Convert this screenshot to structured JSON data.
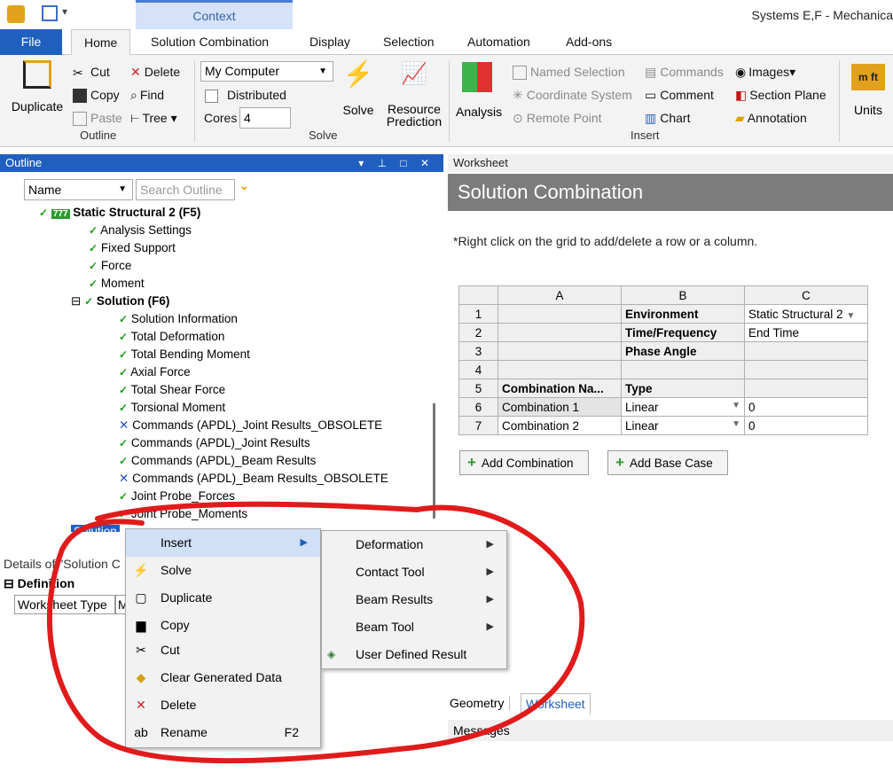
{
  "window": {
    "context_tab": "Context",
    "title": "Systems E,F - Mechanica"
  },
  "tabs": [
    "File",
    "Home",
    "Solution Combination",
    "Display",
    "Selection",
    "Automation",
    "Add-ons"
  ],
  "ribbon": {
    "outline": {
      "duplicate": "Duplicate",
      "cut": "Cut",
      "copy": "Copy",
      "paste": "Paste",
      "delete": "Delete",
      "find": "Find",
      "tree": "Tree",
      "group": "Outline"
    },
    "solve": {
      "computer": "My Computer",
      "distributed": "Distributed",
      "cores_label": "Cores",
      "cores_value": "4",
      "solve": "Solve",
      "resource": "Resource",
      "prediction": "Prediction",
      "group": "Solve"
    },
    "insert": {
      "analysis": "Analysis",
      "named_selection": "Named Selection",
      "coordinate_system": "Coordinate System",
      "remote_point": "Remote Point",
      "commands": "Commands",
      "comment": "Comment",
      "chart": "Chart",
      "images": "Images",
      "section_plane": "Section Plane",
      "annotation": "Annotation",
      "group": "Insert"
    },
    "units": {
      "label": "Units",
      "icon_text": "m ft"
    }
  },
  "outline": {
    "header": "Outline",
    "filter_name": "Name",
    "search_placeholder": "Search Outline",
    "tree": [
      "Static Structural 2 (F5)",
      "Analysis Settings",
      "Fixed Support",
      "Force",
      "Moment",
      "Solution (F6)",
      "Solution Information",
      "Total Deformation",
      "Total Bending Moment",
      "Axial Force",
      "Total Shear Force",
      "Torsional Moment",
      "Commands (APDL)_Joint Results_OBSOLETE",
      "Commands (APDL)_Joint Results",
      "Commands (APDL)_Beam Results",
      "Commands (APDL)_Beam Results_OBSOLETE",
      "Joint Probe_Forces",
      "Joint Probe_Moments",
      "Solution"
    ]
  },
  "details": {
    "header": "Details of \"Solution C",
    "section": "Definition",
    "row_label": "Worksheet Type",
    "row_value": "M"
  },
  "worksheet": {
    "header": "Worksheet",
    "title": "Solution Combination",
    "note": "*Right click on the grid to add/delete a row or a column.",
    "columns": [
      "A",
      "B",
      "C"
    ],
    "rows": [
      [
        "1",
        "",
        "Environment",
        "Static Structural 2"
      ],
      [
        "2",
        "",
        "Time/Frequency",
        "End Time"
      ],
      [
        "3",
        "",
        "Phase Angle",
        ""
      ],
      [
        "4",
        "",
        "",
        ""
      ],
      [
        "5",
        "Combination Na...",
        "Type",
        ""
      ],
      [
        "6",
        "Combination 1",
        "Linear",
        "0"
      ],
      [
        "7",
        "Combination 2",
        "Linear",
        "0"
      ]
    ],
    "add_combination": "Add Combination",
    "add_base_case": "Add Base Case",
    "tab_geometry": "Geometry",
    "tab_worksheet": "Worksheet",
    "messages": "Messages"
  },
  "context_menu": {
    "items": [
      "Insert",
      "Solve",
      "Duplicate",
      "Copy",
      "Cut",
      "Clear Generated Data",
      "Delete",
      "Rename"
    ],
    "rename_shortcut": "F2"
  },
  "submenu": {
    "items": [
      "Deformation",
      "Contact Tool",
      "Beam Results",
      "Beam Tool",
      "User Defined Result"
    ]
  },
  "colors": {
    "accent": "#1f5fbf",
    "annotation": "#e01b1b",
    "check": "#1a9a1a"
  }
}
